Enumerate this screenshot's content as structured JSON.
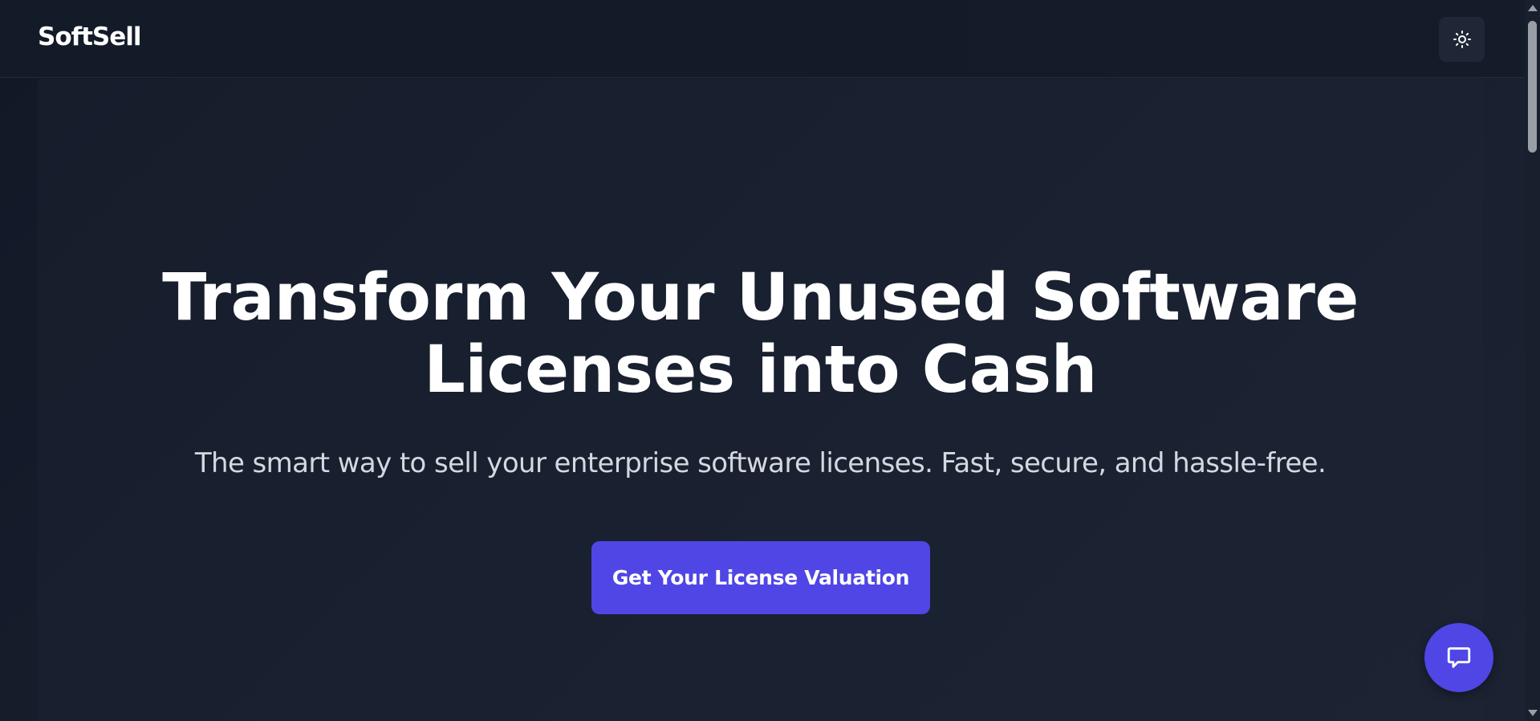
{
  "header": {
    "logo_text": "SoftSell",
    "theme_toggle_icon": "sun-icon"
  },
  "hero": {
    "title_line1": "Transform Your Unused Software",
    "title_line2": "Licenses into Cash",
    "subtitle": "The smart way to sell your enterprise software licenses. Fast, secure, and hassle-free.",
    "cta_label": "Get Your License Valuation"
  },
  "chat": {
    "icon": "chat-bubble-icon"
  },
  "colors": {
    "background": "#151b2a",
    "accent": "#4f46e5",
    "text_primary": "#ffffff",
    "text_secondary": "#d4d8e0"
  }
}
